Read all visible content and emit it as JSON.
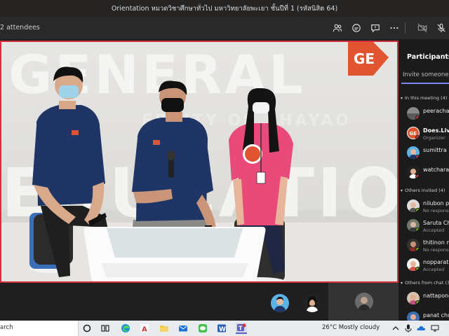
{
  "window": {
    "title": "Orientation หมวดวิชาศึกษาทั่วไป มหาวิทยาลัยพะเยา ชั้นปีที่ 1 (รหัสนิสิต 64)"
  },
  "toolbar": {
    "attendees": "2 attendees",
    "icons": [
      "people-icon",
      "chat-icon",
      "qa-icon",
      "more-icon",
      "camera-off-icon",
      "mic-off-icon"
    ]
  },
  "stage": {
    "backdrop_text_1": "GENERAL",
    "backdrop_text_2": "EDUCATION",
    "backdrop_text_3": "ERSITY OF PHAYAO",
    "logo_text": "GE",
    "accent": "#d3313f"
  },
  "participants": {
    "title": "Participants",
    "invite_placeholder": "Invite someone or",
    "sections": [
      {
        "label": "In this meeting (4)",
        "people": [
          {
            "name": "peerachat a",
            "role": ""
          },
          {
            "name": "Does.Live",
            "role": "Organizer"
          },
          {
            "name": "sumittra in",
            "role": ""
          },
          {
            "name": "watchara la",
            "role": ""
          }
        ]
      },
      {
        "label": "Others invited (4)",
        "people": [
          {
            "name": "nilubon pin",
            "role": "No response"
          },
          {
            "name": "Saruta Cha",
            "role": "Accepted"
          },
          {
            "name": "thitinon ma",
            "role": "No response"
          },
          {
            "name": "nopparat c",
            "role": "Accepted"
          }
        ]
      },
      {
        "label": "Others from chat (3)",
        "people": [
          {
            "name": "nattapong",
            "role": ""
          },
          {
            "name": "panat chue",
            "role": ""
          }
        ]
      }
    ]
  },
  "taskbar": {
    "search": "arch",
    "weather": "26°C  Mostly cloudy"
  }
}
